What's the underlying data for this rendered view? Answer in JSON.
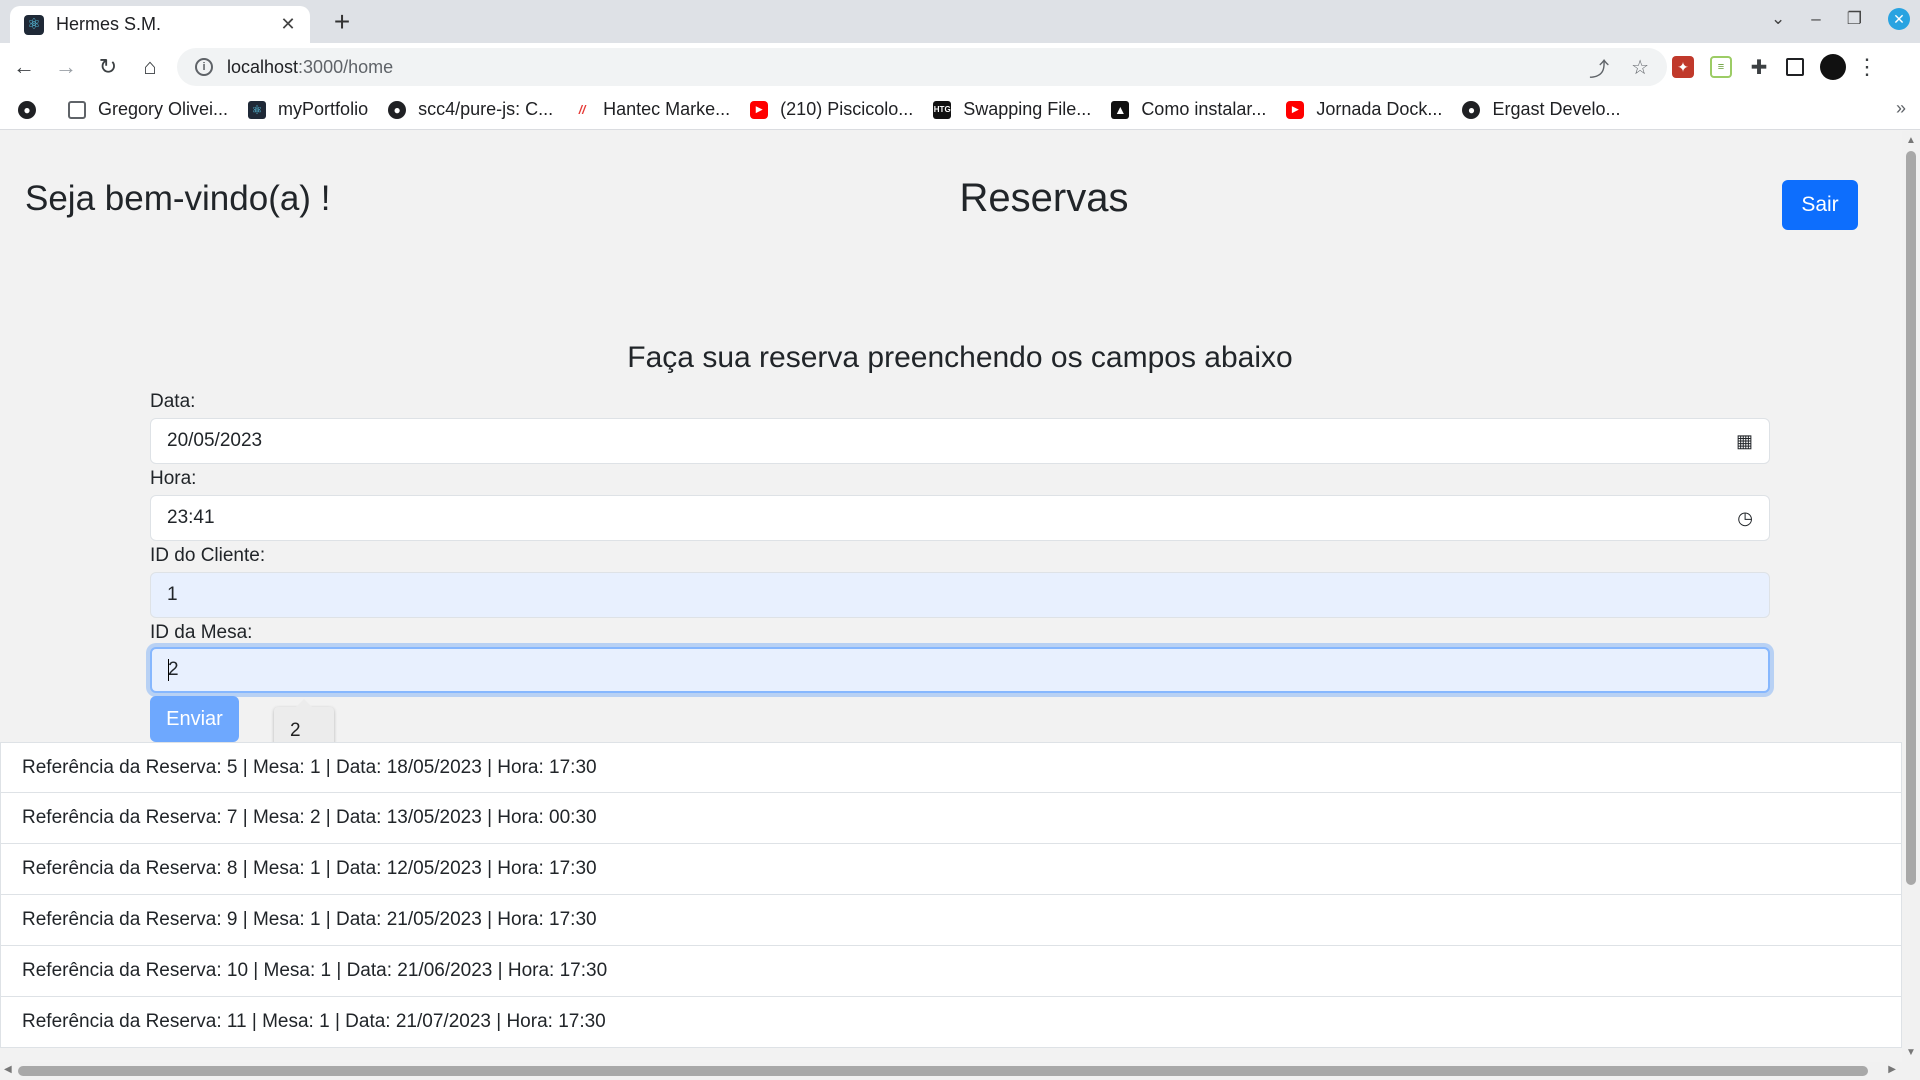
{
  "browser": {
    "tab_title": "Hermes S.M.",
    "tab_close": "✕",
    "new_tab": "+",
    "url_host": "localhost",
    "url_rest": ":3000/home",
    "bookmarks": [
      {
        "label": "Gregory Olivei...",
        "icon": "card-icon"
      },
      {
        "label": "myPortfolio",
        "icon": "react-icon"
      },
      {
        "label": "scc4/pure-js: C...",
        "icon": "github-icon"
      },
      {
        "label": "Hantec Marke...",
        "icon": "hantec-icon"
      },
      {
        "label": "(210) Piscicolo...",
        "icon": "youtube-icon"
      },
      {
        "label": "Swapping File...",
        "icon": "htg-icon"
      },
      {
        "label": "Como instalar...",
        "icon": "site-icon"
      },
      {
        "label": "Jornada Dock...",
        "icon": "youtube-icon"
      },
      {
        "label": "Ergast Develo...",
        "icon": "globe-icon"
      }
    ],
    "bookmarks_more": "»"
  },
  "header": {
    "welcome": "Seja bem-vindo(a) !",
    "title": "Reservas",
    "logout_label": "Sair"
  },
  "form": {
    "heading": "Faça sua reserva preenchendo os campos abaixo",
    "date_label": "Data:",
    "date_value": "20/05/2023",
    "time_label": "Hora:",
    "time_value": "23:41",
    "client_label": "ID do Cliente:",
    "client_value": "1",
    "table_label": "ID da Mesa:",
    "table_value": "2",
    "submit_label": "Enviar",
    "autocomplete_suggestion": "2"
  },
  "reservations": [
    "Referência da Reserva: 5 | Mesa: 1 | Data: 18/05/2023 | Hora: 17:30",
    "Referência da Reserva: 7 | Mesa: 2 | Data: 13/05/2023 | Hora: 00:30",
    "Referência da Reserva: 8 | Mesa: 1 | Data: 12/05/2023 | Hora: 17:30",
    "Referência da Reserva: 9 | Mesa: 1 | Data: 21/05/2023 | Hora: 17:30",
    "Referência da Reserva: 10 | Mesa: 1 | Data: 21/06/2023 | Hora: 17:30",
    "Referência da Reserva: 11 | Mesa: 1 | Data: 21/07/2023 | Hora: 17:30"
  ],
  "colors": {
    "primary": "#0d6efd",
    "primary_disabled": "#6ea8fe",
    "autofill_bg": "#e8f0fe"
  }
}
